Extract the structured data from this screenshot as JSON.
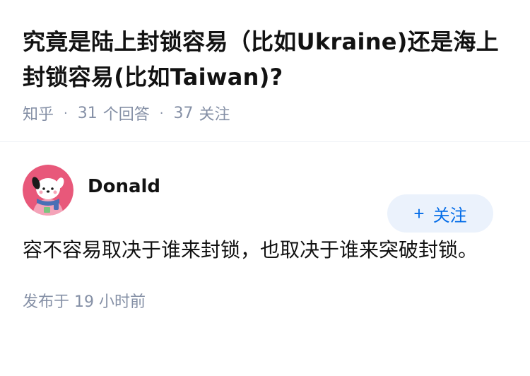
{
  "question": {
    "title": "究竟是陆上封锁容易（比如Ukraine)还是海上封锁容易(比如Taiwan)?",
    "meta": {
      "source": "知乎",
      "answers_count": "31",
      "answers_label": "个回答",
      "followers_count": "37",
      "followers_label": "关注"
    }
  },
  "answer": {
    "author": {
      "name": "Donald"
    },
    "follow_button": {
      "plus": "+",
      "label": "关注"
    },
    "content": "容不容易取决于谁来封锁，也取决于谁来突破封锁。",
    "published": {
      "label": "发布于",
      "value": "19 小时前"
    }
  },
  "colors": {
    "accent": "#056de8",
    "accent_bg": "#ebf2fc",
    "meta_gray": "#8590a6",
    "avatar_bg": "#e8587a"
  }
}
